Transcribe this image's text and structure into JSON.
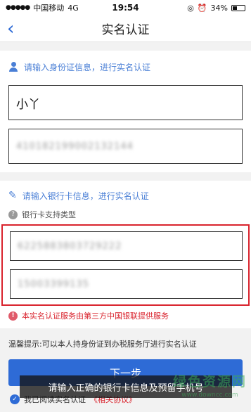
{
  "status_bar": {
    "carrier": "中国移动",
    "network": "4G",
    "time": "19:54",
    "battery": "34%"
  },
  "nav": {
    "title": "实名认证"
  },
  "identity": {
    "hint": "请输入身份证信息，进行实名认证",
    "name_value": "小丫",
    "id_value": "410182199002132144"
  },
  "bank": {
    "hint": "请输入银行卡信息，进行实名认证",
    "support_label": "银行卡支持类型",
    "card_value": "6225883803729222",
    "phone_value": "15003399135",
    "notice": "本实名认证服务由第三方中国银联提供服务"
  },
  "tip": "温馨提示:可以本人持身份证到办税服务厅进行实名认证",
  "next_button": "下一步",
  "agreement": {
    "prefix": "我已阅读实名认证",
    "link": "《相关协议》"
  },
  "caption": "请输入正确的银行卡信息及预留手机号",
  "watermark": {
    "title": "绿色资源网",
    "url": "www.downcc.com"
  },
  "colors": {
    "accent": "#2e6bd6",
    "hint": "#4a7fd6",
    "alert": "#d9232d"
  }
}
